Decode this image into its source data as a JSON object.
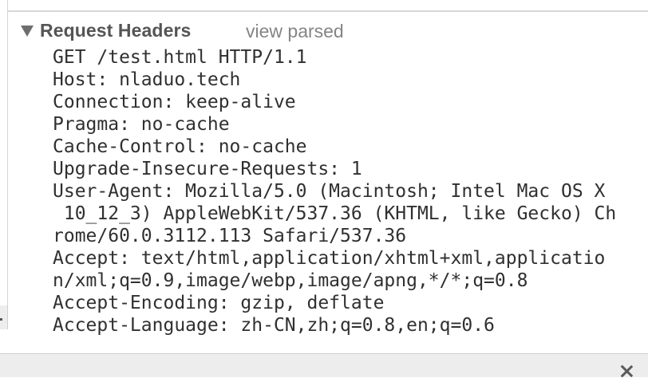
{
  "section": {
    "title": "Request Headers",
    "toggle_icon": "triangle-down-icon",
    "view_parsed_label": "view parsed"
  },
  "header_lines": [
    "GET /test.html HTTP/1.1",
    "Host: nladuo.tech",
    "Connection: keep-alive",
    "Pragma: no-cache",
    "Cache-Control: no-cache",
    "Upgrade-Insecure-Requests: 1",
    "User-Agent: Mozilla/5.0 (Macintosh; Intel Mac OS X",
    " 10_12_3) AppleWebKit/537.36 (KHTML, like Gecko) Ch",
    "rome/60.0.3112.113 Safari/537.36",
    "Accept: text/html,application/xhtml+xml,applicatio",
    "n/xml;q=0.9,image/webp,image/apng,*/*;q=0.8",
    "Accept-Encoding: gzip, deflate",
    "Accept-Language: zh-CN,zh;q=0.8,en;q=0.6"
  ],
  "bottom_bar": {
    "close_icon": "close-icon"
  },
  "colors": {
    "header_text": "#555555",
    "secondary_text": "#858585",
    "body_text": "#303030",
    "bottom_bar_bg": "#ededed"
  }
}
